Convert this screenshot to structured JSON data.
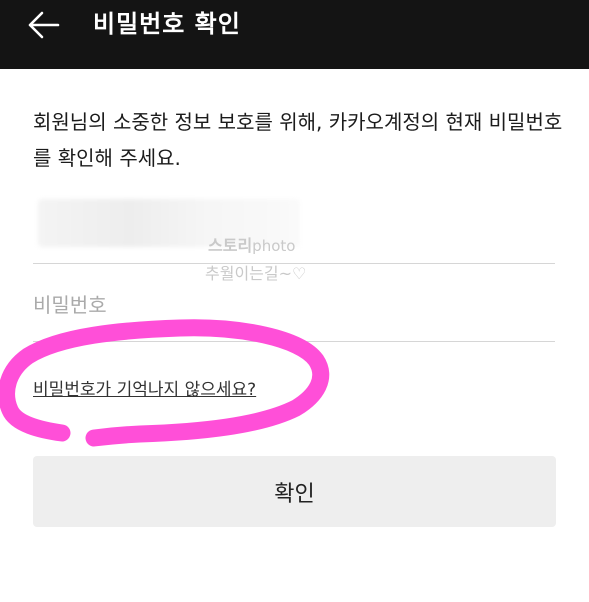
{
  "header": {
    "title": "비밀번호 확인",
    "back_icon": "arrow-left-icon"
  },
  "intro": {
    "text": "회원님의 소중한 정보 보호를 위해, 카카오계정의 현재 비밀번호를 확인해 주세요."
  },
  "form": {
    "password_placeholder": "비밀번호",
    "forgot_link": "비밀번호가 기억나지 않으세요?",
    "confirm_label": "확인"
  },
  "watermark": {
    "line1": "스토리",
    "line1_small": "photo",
    "line2": "추월이는길~♡"
  },
  "colors": {
    "header_bg": "#141414",
    "button_bg": "#eeeeee",
    "annotation": "#ff4fd8"
  }
}
